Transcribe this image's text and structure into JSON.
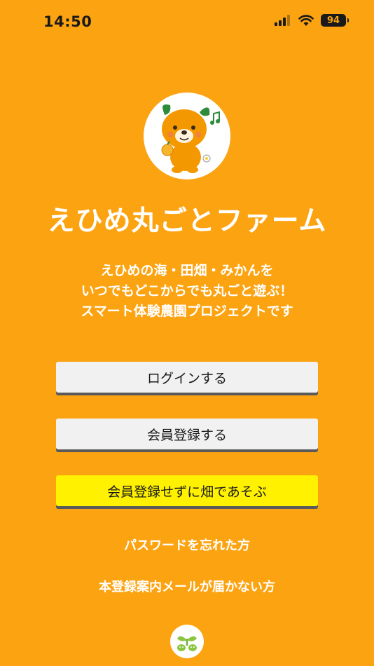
{
  "status_bar": {
    "time": "14:50",
    "battery": "94"
  },
  "mascot": {
    "icon": "mikan-bear-mascot-icon"
  },
  "app": {
    "title": "えひめ丸ごとファーム"
  },
  "description": {
    "line1": "えひめの海・田畑・みかんを",
    "line2": "いつでもどこからでも丸ごと遊ぶ！",
    "line3": "スマート体験農園プロジェクトです"
  },
  "buttons": {
    "login": "ログインする",
    "register": "会員登録する",
    "guest": "会員登録せずに畑であそぶ"
  },
  "links": {
    "forgot_password": "パスワードを忘れた方",
    "no_registration_mail": "本登録案内メールが届かない方"
  },
  "footer": {
    "icon": "sprout-logo-icon"
  },
  "colors": {
    "background": "#FCA311",
    "guest_button": "#FFF100",
    "button": "#F1F1F1",
    "text_light": "#FFFFFF"
  }
}
